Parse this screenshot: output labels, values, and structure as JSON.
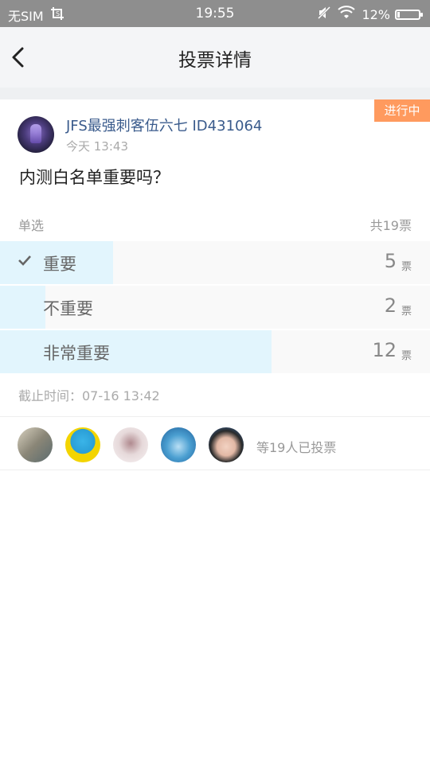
{
  "status_bar": {
    "carrier": "无SIM",
    "time": "19:55",
    "battery": "12%",
    "battery_level": 0.12
  },
  "nav": {
    "title": "投票详情",
    "back_icon": "chevron-left-icon"
  },
  "post": {
    "status_tag": "进行中",
    "author": "JFS最强刺客伍六七  ID431064",
    "time": "今天 13:43",
    "question": "内测白名单重要吗？",
    "vote_type": "单选",
    "total_votes": "共19票",
    "options": [
      {
        "label": "重要",
        "count": "5",
        "unit": "票",
        "selected": true,
        "votes": 5
      },
      {
        "label": "不重要",
        "count": "2",
        "unit": "票",
        "selected": false,
        "votes": 2
      },
      {
        "label": "非常重要",
        "count": "12",
        "unit": "票",
        "selected": false,
        "votes": 12
      }
    ],
    "deadline": "截止时间：07-16 13:42",
    "voters_text": "等19人已投票"
  },
  "colors": {
    "accent_tag": "#ff9a5e",
    "bar_fill": "#e2f5fd",
    "author_name": "#3a5b8c"
  }
}
